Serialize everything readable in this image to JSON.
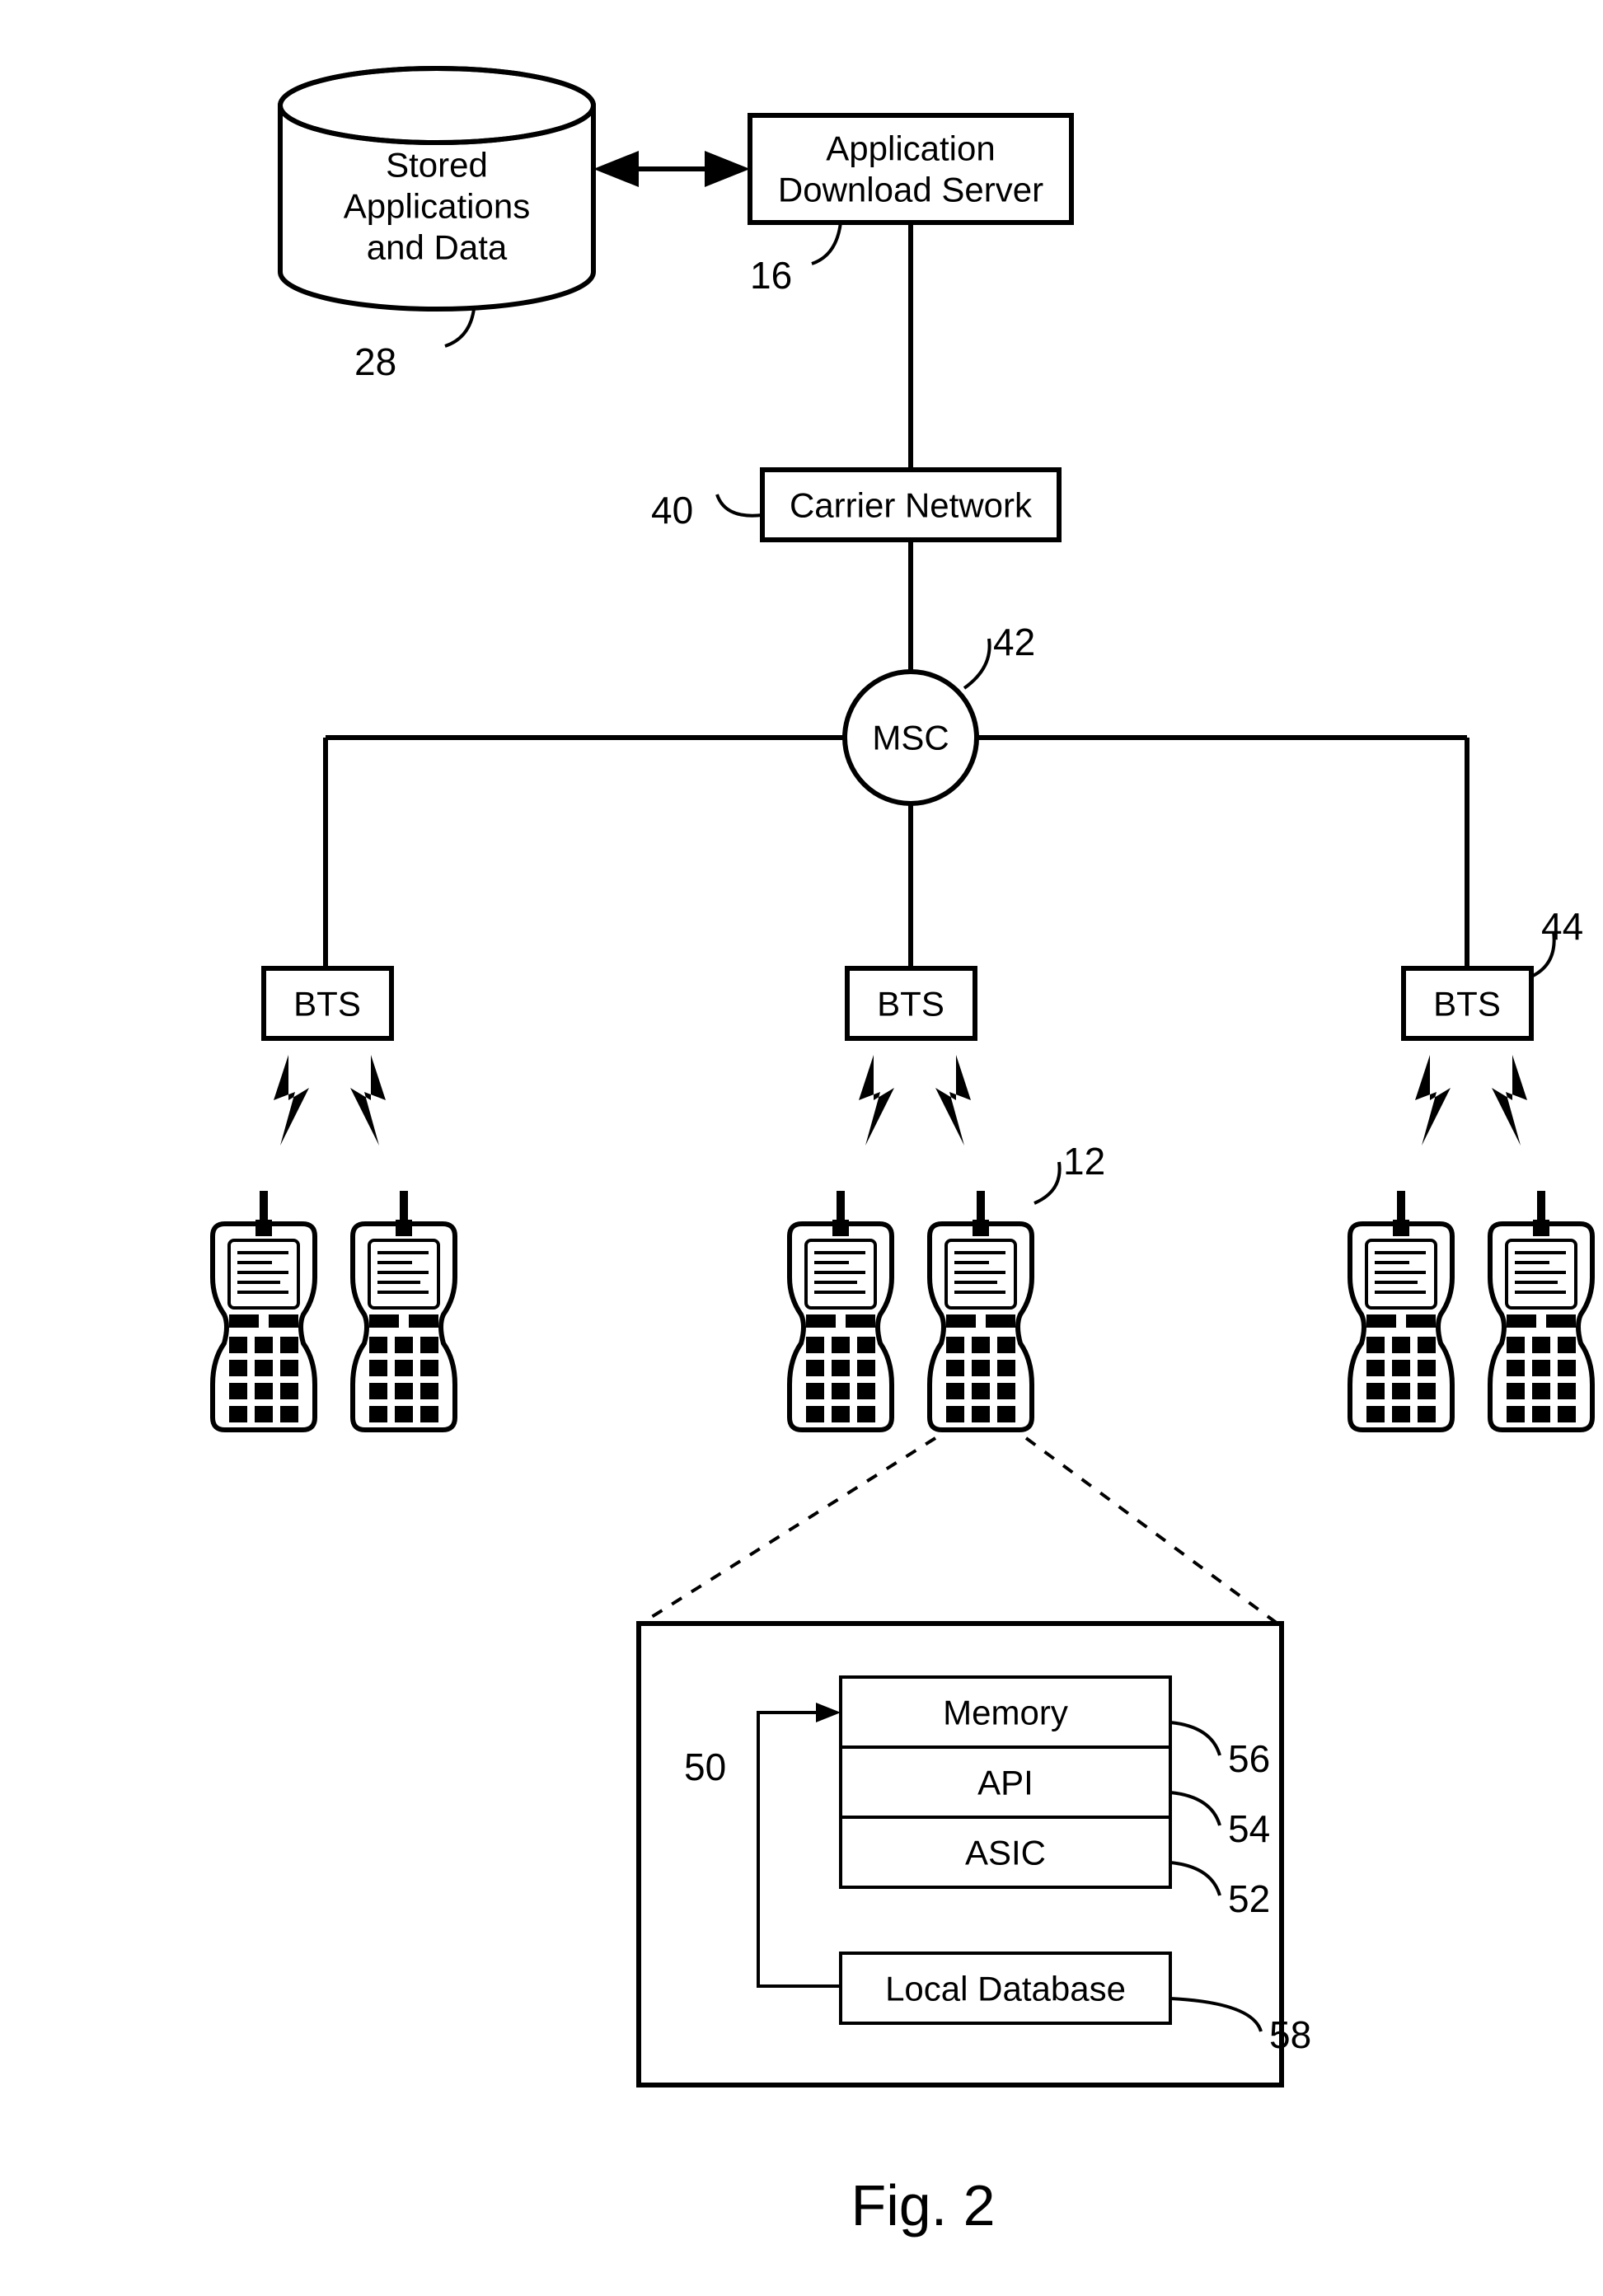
{
  "figure_label": "Fig. 2",
  "nodes": {
    "database": {
      "lines": [
        "Stored",
        "Applications",
        "and Data"
      ],
      "ref": "28"
    },
    "server": {
      "lines": [
        "Application",
        "Download Server"
      ],
      "ref": "16"
    },
    "carrier": {
      "label": "Carrier Network",
      "ref": "40"
    },
    "msc": {
      "label": "MSC",
      "ref": "42"
    },
    "bts": {
      "label": "BTS",
      "ref": "44"
    },
    "phone_ref": "12",
    "detail": {
      "memory": "Memory",
      "memory_ref": "56",
      "api": "API",
      "api_ref": "54",
      "asic": "ASIC",
      "asic_ref": "52",
      "localdb": "Local Database",
      "localdb_ref": "58",
      "loop_ref": "50"
    }
  },
  "chart_data": {
    "type": "diagram",
    "description": "Cellular network architecture block diagram",
    "elements": [
      {
        "id": 28,
        "label": "Stored Applications and Data",
        "shape": "cylinder"
      },
      {
        "id": 16,
        "label": "Application Download Server",
        "shape": "rect"
      },
      {
        "id": 40,
        "label": "Carrier Network",
        "shape": "rect"
      },
      {
        "id": 42,
        "label": "MSC",
        "shape": "circle"
      },
      {
        "id": 44,
        "label": "BTS",
        "shape": "rect",
        "count": 3
      },
      {
        "id": 12,
        "label": "Mobile Device",
        "shape": "phone",
        "count": 6
      },
      {
        "id": 50,
        "label": "Internal bus/loop",
        "shape": "path"
      },
      {
        "id": 56,
        "label": "Memory",
        "shape": "rect"
      },
      {
        "id": 54,
        "label": "API",
        "shape": "rect"
      },
      {
        "id": 52,
        "label": "ASIC",
        "shape": "rect"
      },
      {
        "id": 58,
        "label": "Local Database",
        "shape": "rect"
      }
    ],
    "edges": [
      {
        "from": 28,
        "to": 16,
        "style": "double-arrow"
      },
      {
        "from": 16,
        "to": 40,
        "style": "line"
      },
      {
        "from": 40,
        "to": 42,
        "style": "line"
      },
      {
        "from": 42,
        "to": 44,
        "style": "line",
        "note": "to each of 3 BTS"
      },
      {
        "from": 44,
        "to": 12,
        "style": "wireless",
        "note": "each BTS to 2 phones"
      },
      {
        "from": 12,
        "to": "detail-box",
        "style": "dashed-projection"
      },
      {
        "from": 50,
        "to": 56,
        "style": "arrow"
      },
      {
        "from": 50,
        "to": 58,
        "style": "line"
      }
    ]
  }
}
